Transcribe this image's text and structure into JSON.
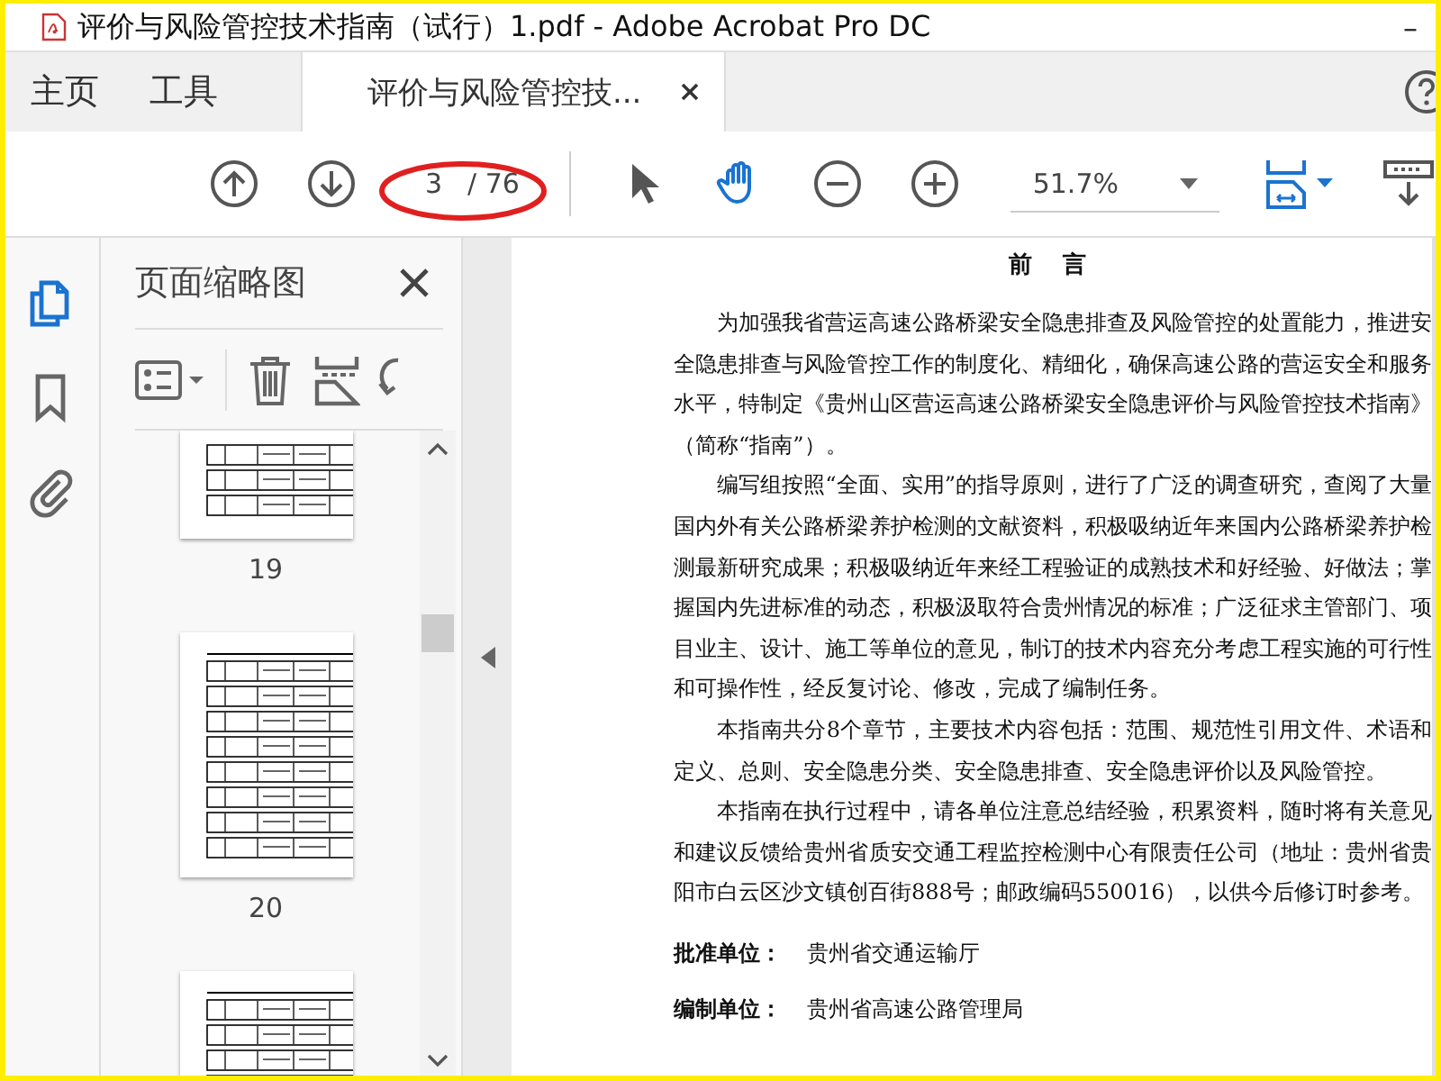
{
  "window": {
    "title": "评价与风险管控技术指南（试行）1.pdf - Adobe Acrobat Pro DC",
    "minimize": "–"
  },
  "tabs": [
    {
      "label": "主页",
      "selected": false,
      "closable": false
    },
    {
      "label": "工具",
      "selected": false,
      "closable": false
    },
    {
      "label": "评价与风险管控技...",
      "selected": true,
      "closable": true
    }
  ],
  "toolbar": {
    "page_number": "3",
    "page_count": "/ 76",
    "zoom": "51.7%",
    "tools": [
      {
        "kind": "select",
        "selected": false
      },
      {
        "kind": "hand",
        "selected": true
      }
    ]
  },
  "sidebar": {
    "items": [
      {
        "kind": "pages",
        "selected": true
      },
      {
        "kind": "bookmarks",
        "selected": false
      },
      {
        "kind": "attachments",
        "selected": false
      }
    ]
  },
  "thumbnails_panel": {
    "title": "页面缩略图",
    "pages": [
      "19",
      "20"
    ]
  },
  "document": {
    "heading": "前 言",
    "paragraphs": [
      "为加强我省营运高速公路桥梁安全隐患排查及风险管控的处置能力，推进安全隐患排查与风险管控工作的制度化、精细化，确保高速公路的营运安全和服务水平，特制定《贵州山区营运高速公路桥梁安全隐患评价与风险管控技术指南》（简称“指南”）。",
      "编写组按照“全面、实用”的指导原则，进行了广泛的调查研究，查阅了大量国内外有关公路桥梁养护检测的文献资料，积极吸纳近年来国内公路桥梁养护检测最新研究成果；积极吸纳近年来经工程验证的成熟技术和好经验、好做法；掌握国内先进标准的动态，积极汲取符合贵州情况的标准；广泛征求主管部门、项目业主、设计、施工等单位的意见，制订的技术内容充分考虑工程实施的可行性和可操作性，经反复讨论、修改，完成了编制任务。",
      "本指南共分8个章节，主要技术内容包括：范围、规范性引用文件、术语和定义、总则、安全隐患分类、安全隐患排查、安全隐患评价以及风险管控。",
      "本指南在执行过程中，请各单位注意总结经验，积累资料，随时将有关意见和建议反馈给贵州省质安交通工程监控检测中心有限责任公司（地址：贵州省贵阳市白云区沙文镇创百街888号；邮政编码550016），以供今后修订时参考。"
    ],
    "signatures": [
      {
        "label": "批准单位：",
        "value": "贵州省交通运输厅"
      },
      {
        "label": "编制单位：",
        "value": "贵州省高速公路管理局"
      }
    ]
  }
}
